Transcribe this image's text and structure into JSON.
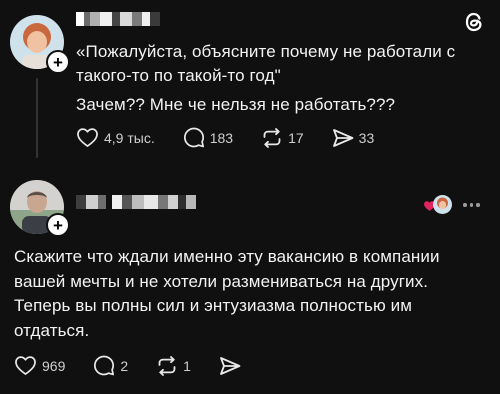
{
  "post1": {
    "line1": "«Пожалуйста, объясните почему не работали с",
    "line2": "такого-то по такой-то год\"",
    "line3": "Зачем?? Мне че нельзя не работать???",
    "likes": "4,9 тыс.",
    "replies": "183",
    "reposts": "17",
    "shares": "33",
    "plus_glyph": "+"
  },
  "post2": {
    "line1": "Скажите что ждали именно эту вакансию в компании",
    "line2": "вашей мечты и не хотели размениваться на других.",
    "line3": "Теперь вы полны сил и энтузиазма полностью им",
    "line4": "отдаться.",
    "likes": "969",
    "replies": "2",
    "reposts": "1",
    "plus_glyph": "+"
  },
  "icons": {
    "app_logo": "threads-logo-icon",
    "like": "heart-icon",
    "reply": "comment-icon",
    "repost": "repost-icon",
    "share": "send-icon",
    "more": "more-dots-icon"
  },
  "colors": {
    "background": "#101010",
    "text": "#f3f3f3",
    "muted": "#cfcfcf",
    "heart_badge": "#e0245e"
  }
}
